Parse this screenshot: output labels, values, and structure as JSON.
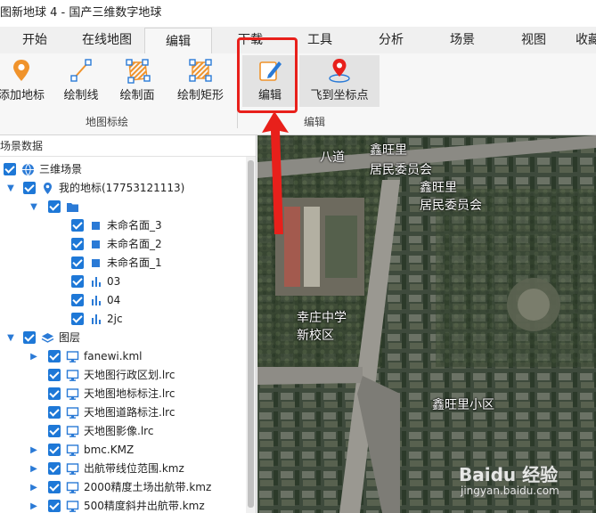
{
  "window": {
    "title": "图新地球 4 - 国产三维数字地球"
  },
  "tabs": [
    {
      "label": "开始"
    },
    {
      "label": "在线地图"
    },
    {
      "label": "编辑"
    },
    {
      "label": "下载"
    },
    {
      "label": "工具"
    },
    {
      "label": "分析"
    },
    {
      "label": "场景"
    },
    {
      "label": "视图"
    },
    {
      "label": "收藏"
    }
  ],
  "ribbon": {
    "buttons": [
      {
        "label": "添加地标",
        "icon": "placemark-pin-icon"
      },
      {
        "label": "绘制线",
        "icon": "draw-line-icon"
      },
      {
        "label": "绘制面",
        "icon": "draw-polygon-icon"
      },
      {
        "label": "绘制矩形",
        "icon": "draw-rectangle-icon"
      },
      {
        "label": "编辑",
        "icon": "edit-pencil-icon"
      },
      {
        "label": "飞到坐标点",
        "icon": "fly-to-point-icon"
      }
    ],
    "groups": [
      {
        "label": "地图标绘"
      },
      {
        "label": "编辑"
      }
    ]
  },
  "panel": {
    "title": "场景数据",
    "tree": [
      {
        "label": "三维场景",
        "level": 0,
        "expander": "",
        "icon": "globe-icon"
      },
      {
        "label": "我的地标(17753121113)",
        "level": 0,
        "expander": "▼",
        "icon": "placemark-icon"
      },
      {
        "label": "",
        "level": 1,
        "expander": "▼",
        "icon": "folder-icon"
      },
      {
        "label": "未命名面_3",
        "level": 2,
        "expander": "",
        "icon": "polygon-square-icon"
      },
      {
        "label": "未命名面_2",
        "level": 2,
        "expander": "",
        "icon": "polygon-square-icon"
      },
      {
        "label": "未命名面_1",
        "level": 2,
        "expander": "",
        "icon": "polygon-square-icon"
      },
      {
        "label": "03",
        "level": 2,
        "expander": "",
        "icon": "bar-chart-icon"
      },
      {
        "label": "04",
        "level": 2,
        "expander": "",
        "icon": "bar-chart-icon"
      },
      {
        "label": "2jc",
        "level": 2,
        "expander": "",
        "icon": "bar-chart-icon"
      },
      {
        "label": "图层",
        "level": 0,
        "expander": "▼",
        "icon": "layers-icon"
      },
      {
        "label": "fanewi.kml",
        "level": 1,
        "expander": "▶",
        "icon": "monitor-icon"
      },
      {
        "label": "天地图行政区划.lrc",
        "level": 1,
        "expander": "",
        "icon": "monitor-icon"
      },
      {
        "label": "天地图地标标注.lrc",
        "level": 1,
        "expander": "",
        "icon": "monitor-icon"
      },
      {
        "label": "天地图道路标注.lrc",
        "level": 1,
        "expander": "",
        "icon": "monitor-icon"
      },
      {
        "label": "天地图影像.lrc",
        "level": 1,
        "expander": "",
        "icon": "monitor-icon"
      },
      {
        "label": "bmc.KMZ",
        "level": 1,
        "expander": "▶",
        "icon": "monitor-icon"
      },
      {
        "label": "出航带线位范围.kmz",
        "level": 1,
        "expander": "▶",
        "icon": "monitor-icon"
      },
      {
        "label": "2000精度土场出航带.kmz",
        "level": 1,
        "expander": "▶",
        "icon": "monitor-icon"
      },
      {
        "label": "500精度斜井出航带.kmz",
        "level": 1,
        "expander": "▶",
        "icon": "monitor-icon"
      }
    ]
  },
  "map": {
    "labels": [
      {
        "text": "鑫旺里"
      },
      {
        "text": "居民委员会"
      },
      {
        "text": "鑫旺里"
      },
      {
        "text": "居民委员会"
      },
      {
        "text": "幸庄中学"
      },
      {
        "text": "新校区"
      },
      {
        "text": "鑫旺里小区"
      },
      {
        "text": "八道"
      }
    ],
    "watermark": {
      "main": "Baidu 经验",
      "sub": "jingyan.baidu.com"
    }
  },
  "colors": {
    "accent": "#1e78d7",
    "annotation": "#e8201b",
    "ribbon_bg": "#f7f7f7"
  }
}
